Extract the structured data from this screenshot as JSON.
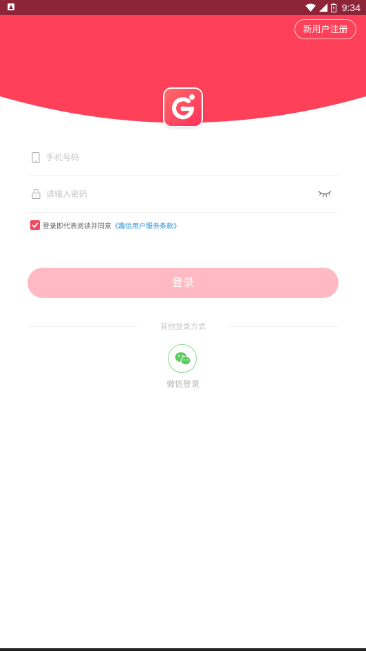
{
  "status_bar": {
    "time": "9:34"
  },
  "header": {
    "register_label": "新用户注册"
  },
  "form": {
    "phone_placeholder": "手机号码",
    "password_placeholder": "请输入密码"
  },
  "agreement": {
    "checked": true,
    "prefix": "登录即代表阅读并同意",
    "link": "《趣信用户服务条款》"
  },
  "login_button_label": "登录",
  "other_login": {
    "title": "其他登录方式",
    "wechat_label": "微信登录"
  },
  "colors": {
    "status_bar": "#8e2438",
    "header": "#ff4059",
    "login_button": "#ffb9c2",
    "link": "#2f8fd8",
    "wechat": "#5ec95e"
  },
  "icons": [
    "android-notification-icon",
    "wifi-icon",
    "signal-icon",
    "battery-icon",
    "app-logo",
    "phone-icon",
    "lock-icon",
    "eye-closed-icon",
    "check-icon",
    "wechat-icon"
  ]
}
